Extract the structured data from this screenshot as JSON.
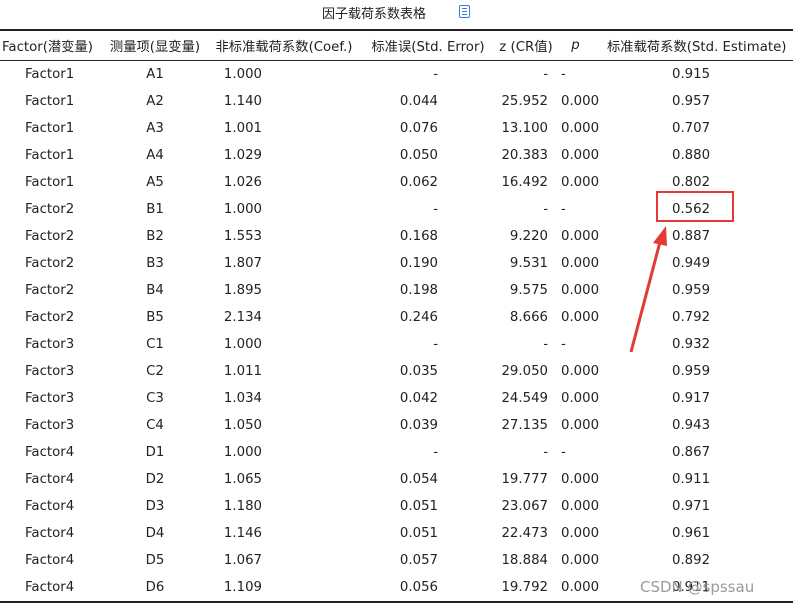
{
  "title": "因子载荷系数表格",
  "headers": [
    "Factor(潜变量)",
    "测量项(显变量)",
    "非标准载荷系数(Coef.)",
    "标准误(Std. Error)",
    "z (CR值)",
    "p",
    "标准载荷系数(Std. Estimate)"
  ],
  "rows": [
    [
      "Factor1",
      "A1",
      "1.000",
      "-",
      "-",
      "-",
      "0.915"
    ],
    [
      "Factor1",
      "A2",
      "1.140",
      "0.044",
      "25.952",
      "0.000",
      "0.957"
    ],
    [
      "Factor1",
      "A3",
      "1.001",
      "0.076",
      "13.100",
      "0.000",
      "0.707"
    ],
    [
      "Factor1",
      "A4",
      "1.029",
      "0.050",
      "20.383",
      "0.000",
      "0.880"
    ],
    [
      "Factor1",
      "A5",
      "1.026",
      "0.062",
      "16.492",
      "0.000",
      "0.802"
    ],
    [
      "Factor2",
      "B1",
      "1.000",
      "-",
      "-",
      "-",
      "0.562"
    ],
    [
      "Factor2",
      "B2",
      "1.553",
      "0.168",
      "9.220",
      "0.000",
      "0.887"
    ],
    [
      "Factor2",
      "B3",
      "1.807",
      "0.190",
      "9.531",
      "0.000",
      "0.949"
    ],
    [
      "Factor2",
      "B4",
      "1.895",
      "0.198",
      "9.575",
      "0.000",
      "0.959"
    ],
    [
      "Factor2",
      "B5",
      "2.134",
      "0.246",
      "8.666",
      "0.000",
      "0.792"
    ],
    [
      "Factor3",
      "C1",
      "1.000",
      "-",
      "-",
      "-",
      "0.932"
    ],
    [
      "Factor3",
      "C2",
      "1.011",
      "0.035",
      "29.050",
      "0.000",
      "0.959"
    ],
    [
      "Factor3",
      "C3",
      "1.034",
      "0.042",
      "24.549",
      "0.000",
      "0.917"
    ],
    [
      "Factor3",
      "C4",
      "1.050",
      "0.039",
      "27.135",
      "0.000",
      "0.943"
    ],
    [
      "Factor4",
      "D1",
      "1.000",
      "-",
      "-",
      "-",
      "0.867"
    ],
    [
      "Factor4",
      "D2",
      "1.065",
      "0.054",
      "19.777",
      "0.000",
      "0.911"
    ],
    [
      "Factor4",
      "D3",
      "1.180",
      "0.051",
      "23.067",
      "0.000",
      "0.971"
    ],
    [
      "Factor4",
      "D4",
      "1.146",
      "0.051",
      "22.473",
      "0.000",
      "0.961"
    ],
    [
      "Factor4",
      "D5",
      "1.067",
      "0.057",
      "18.884",
      "0.000",
      "0.892"
    ],
    [
      "Factor4",
      "D6",
      "1.109",
      "0.056",
      "19.792",
      "0.000",
      "0.911"
    ]
  ],
  "icon": "document-icon",
  "highlight_color": "#e53935",
  "watermark": "CSDN @spssau"
}
